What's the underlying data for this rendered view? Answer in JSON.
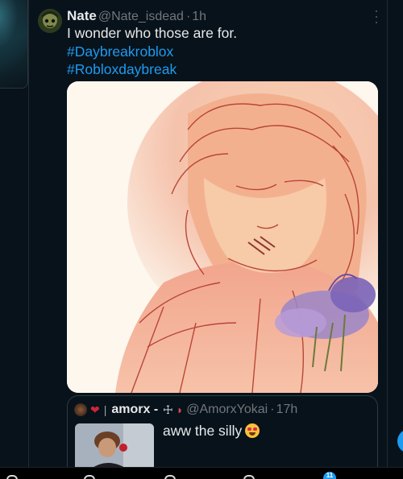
{
  "tweet": {
    "author_name": "Nate",
    "handle": "@Nate_isdead",
    "separator": "·",
    "time": "1h",
    "text_line1": "I wonder who those are for.",
    "hashtags": [
      "#Daybreakroblox",
      "#Robloxdaybreak"
    ],
    "image_alt": "Sketch illustration of a character with wild hair holding purple flowers"
  },
  "quote": {
    "name": "amorx -",
    "cross_symbol": "☩",
    "handle": "@AmorxYokai",
    "separator": "·",
    "time": "17h",
    "text": "aww the silly"
  },
  "bottom_nav": {
    "notification_count": "11"
  },
  "colors": {
    "background": "#08121a",
    "link": "#1d9bf0",
    "secondary_text": "#71767b"
  },
  "icons": [
    "more-options-icon",
    "avatar",
    "heart-eyes-emoji-icon",
    "drop-of-blood-emoji-icon",
    "watermelon-emoji-icon"
  ]
}
